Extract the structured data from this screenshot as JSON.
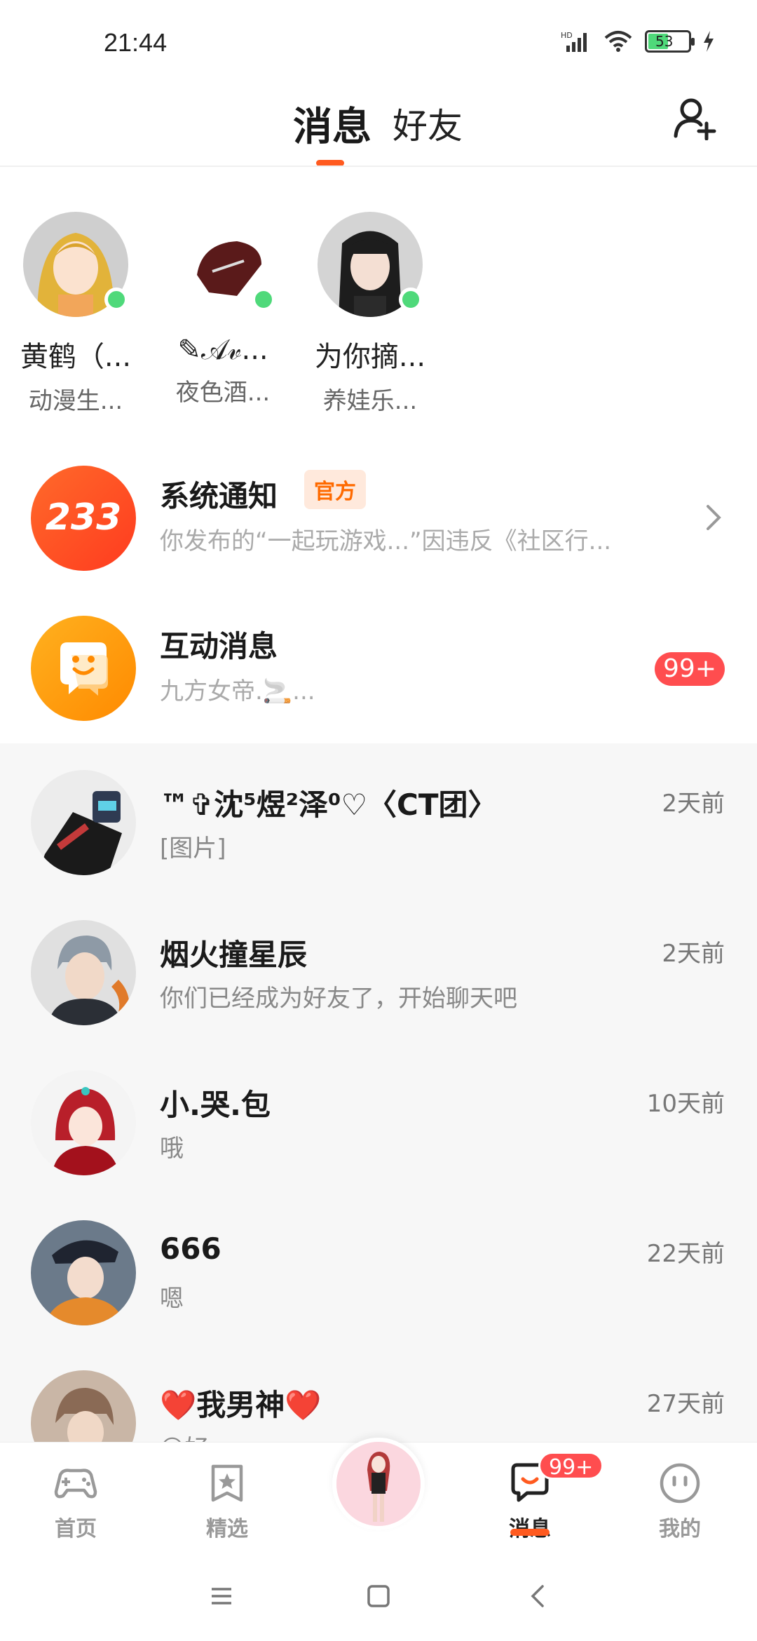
{
  "status_bar": {
    "time": "21:44",
    "battery": "53"
  },
  "header": {
    "tabs": [
      {
        "label": "消息",
        "active": true
      },
      {
        "label": "好友",
        "active": false
      }
    ],
    "accent_color": "#ff5a1f"
  },
  "online_friends": [
    {
      "name": "黄鹤（...",
      "status": "动漫生..."
    },
    {
      "name": "✎𝒜𝓋...",
      "status": "夜色酒..."
    },
    {
      "name": "为你摘...",
      "status": "养娃乐..."
    }
  ],
  "system_notice": {
    "logo": "233",
    "title": "系统通知",
    "badge": "官方",
    "preview": "你发布的“一起玩游戏...”因违反《社区行..."
  },
  "interaction": {
    "title": "互动消息",
    "preview": "九方女帝.🚬...",
    "unread": "99+"
  },
  "chats": [
    {
      "name": "™✞沈⁵煜²泽⁰♡〈CT团〉",
      "message": "[图片]",
      "time": "2天前"
    },
    {
      "name": "烟火撞星辰",
      "message": "你们已经成为好友了，开始聊天吧",
      "time": "2天前"
    },
    {
      "name": "小.哭.包",
      "message": "哦",
      "time": "10天前"
    },
    {
      "name": "666",
      "message": "嗯",
      "time": "22天前"
    },
    {
      "name": "❤️我男神❤️",
      "message": "😊好",
      "time": "27天前"
    }
  ],
  "bottom_nav": {
    "items": [
      {
        "label": "首页",
        "icon": "gamepad-icon"
      },
      {
        "label": "精选",
        "icon": "star-bookmark-icon"
      },
      {
        "label": "消息",
        "icon": "chat-bubble-icon",
        "badge": "99+"
      },
      {
        "label": "我的",
        "icon": "face-icon"
      }
    ]
  }
}
